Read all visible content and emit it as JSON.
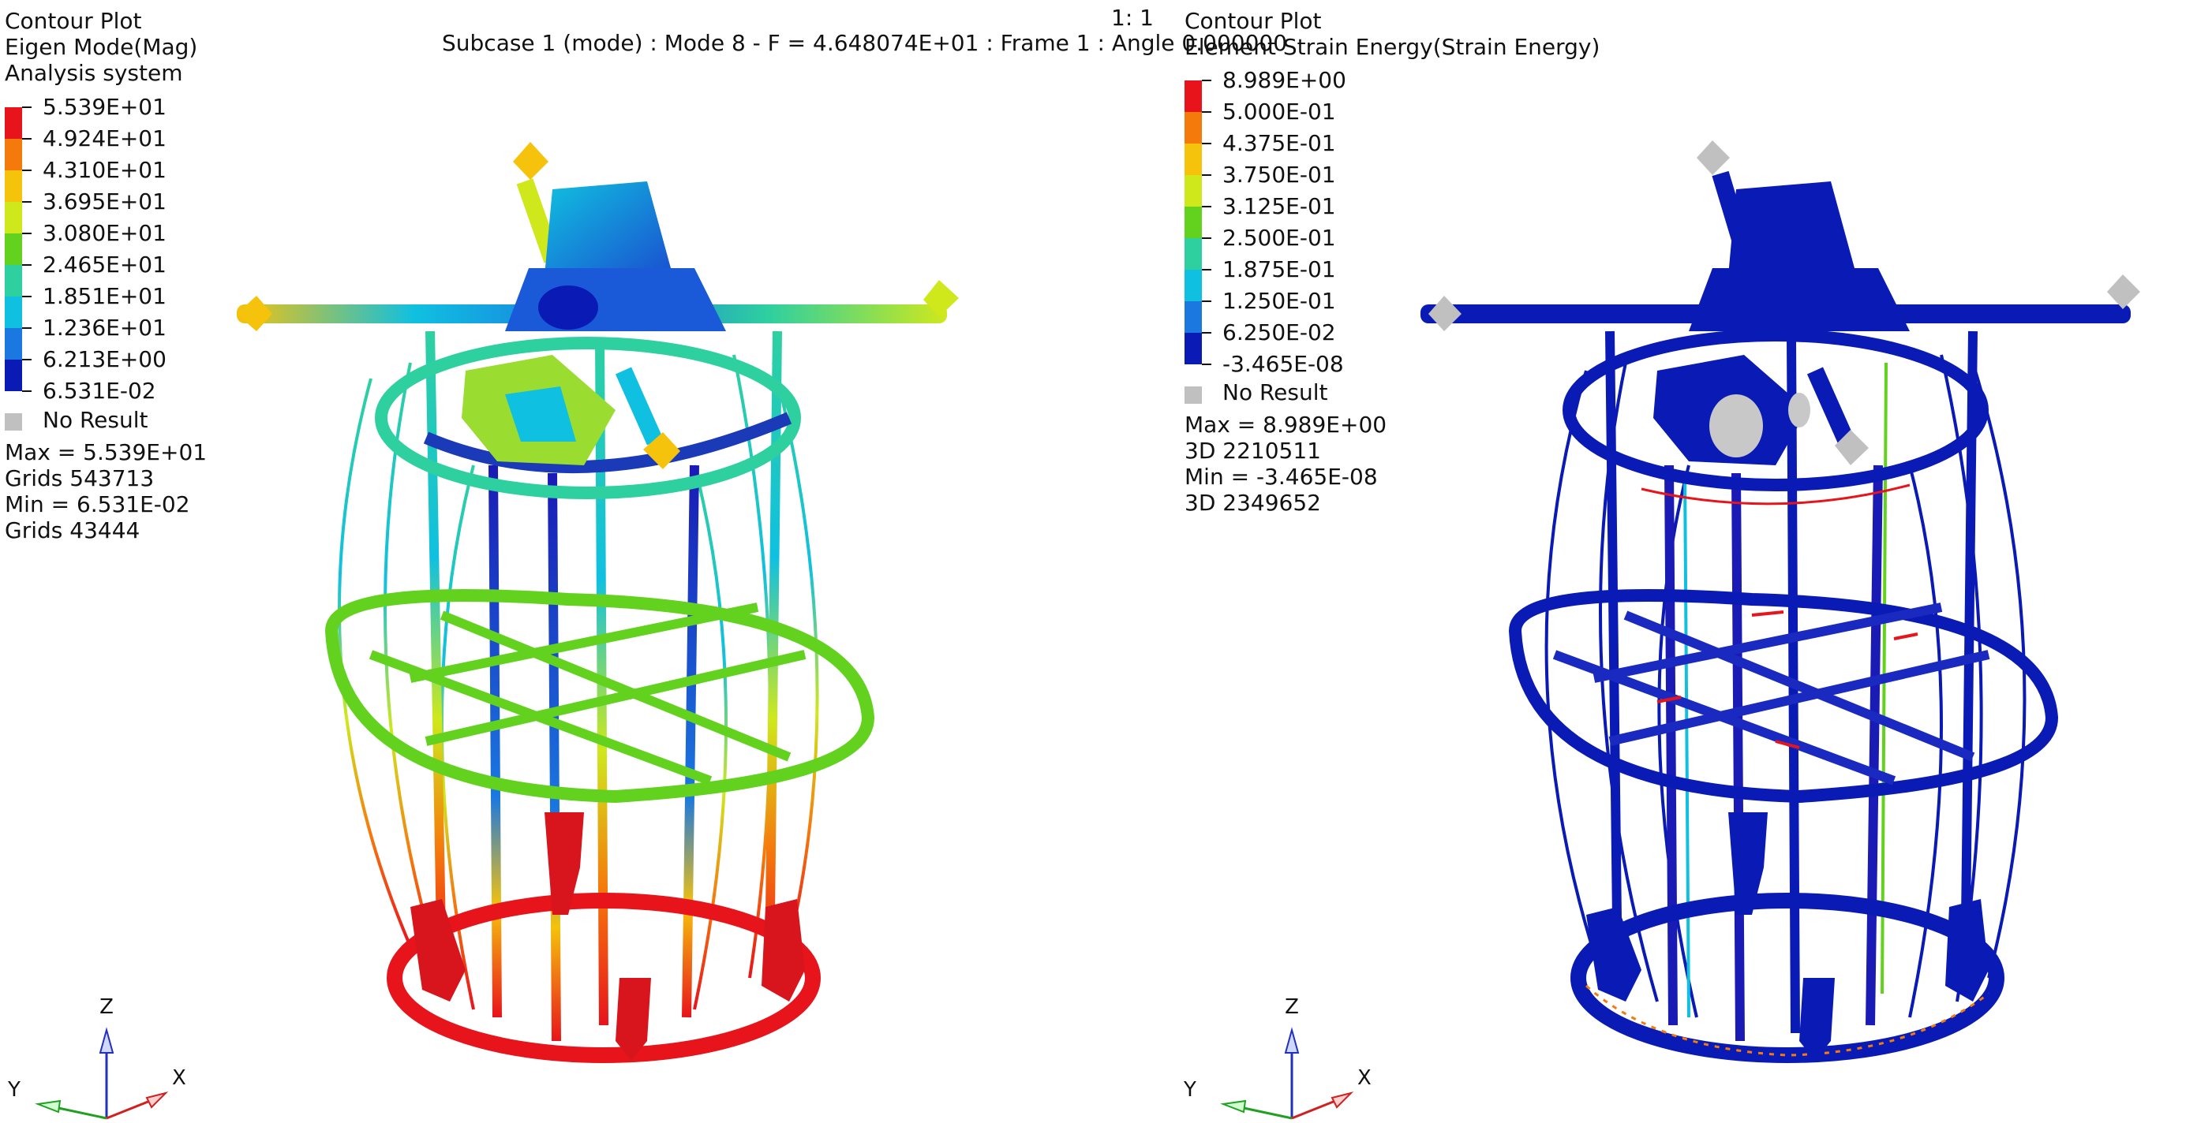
{
  "header": {
    "scale": "1: 1",
    "subcase": "Subcase 1 (mode) : Mode 8 - F = 4.648074E+01 : Frame 1 : Angle 0.000000"
  },
  "left_panel": {
    "title_lines": [
      "Contour Plot",
      "Eigen Mode(Mag)",
      "Analysis system"
    ],
    "legend_labels": [
      "5.539E+01",
      "4.924E+01",
      "4.310E+01",
      "3.695E+01",
      "3.080E+01",
      "2.465E+01",
      "1.851E+01",
      "1.236E+01",
      "6.213E+00",
      "6.531E-02"
    ],
    "legend_colors": [
      "#e8141c",
      "#f57a0c",
      "#f5c20c",
      "#cfe81c",
      "#62d21e",
      "#2ed0a0",
      "#10c0e0",
      "#1a78e0",
      "#0a1ab4"
    ],
    "no_result": "No Result",
    "stats": [
      "Max =  5.539E+01",
      "Grids 543713",
      "Min =  6.531E-02",
      "Grids 43444"
    ]
  },
  "right_panel": {
    "title_lines": [
      "Contour Plot",
      "Element Strain Energy(Strain Energy)"
    ],
    "legend_labels": [
      "8.989E+00",
      "5.000E-01",
      "4.375E-01",
      "3.750E-01",
      "3.125E-01",
      "2.500E-01",
      "1.875E-01",
      "1.250E-01",
      "6.250E-02",
      "-3.465E-08"
    ],
    "legend_colors": [
      "#e8141c",
      "#f57a0c",
      "#f5c20c",
      "#cfe81c",
      "#62d21e",
      "#2ed0a0",
      "#10c0e0",
      "#1a78e0",
      "#0a1ab4"
    ],
    "no_result": "No Result",
    "stats": [
      "Max =  8.989E+00",
      "3D 2210511",
      "Min =  -3.465E-08",
      "3D 2349652"
    ]
  },
  "triad": {
    "z": "Z",
    "y": "Y",
    "x": "X"
  },
  "colors": {
    "red": "#e8141c",
    "orange": "#f57a0c",
    "yellow": "#f5c20c",
    "green": "#62d21e",
    "cyan": "#10c0e0",
    "blue": "#0a1ab4",
    "grey": "#c0c0c0"
  }
}
